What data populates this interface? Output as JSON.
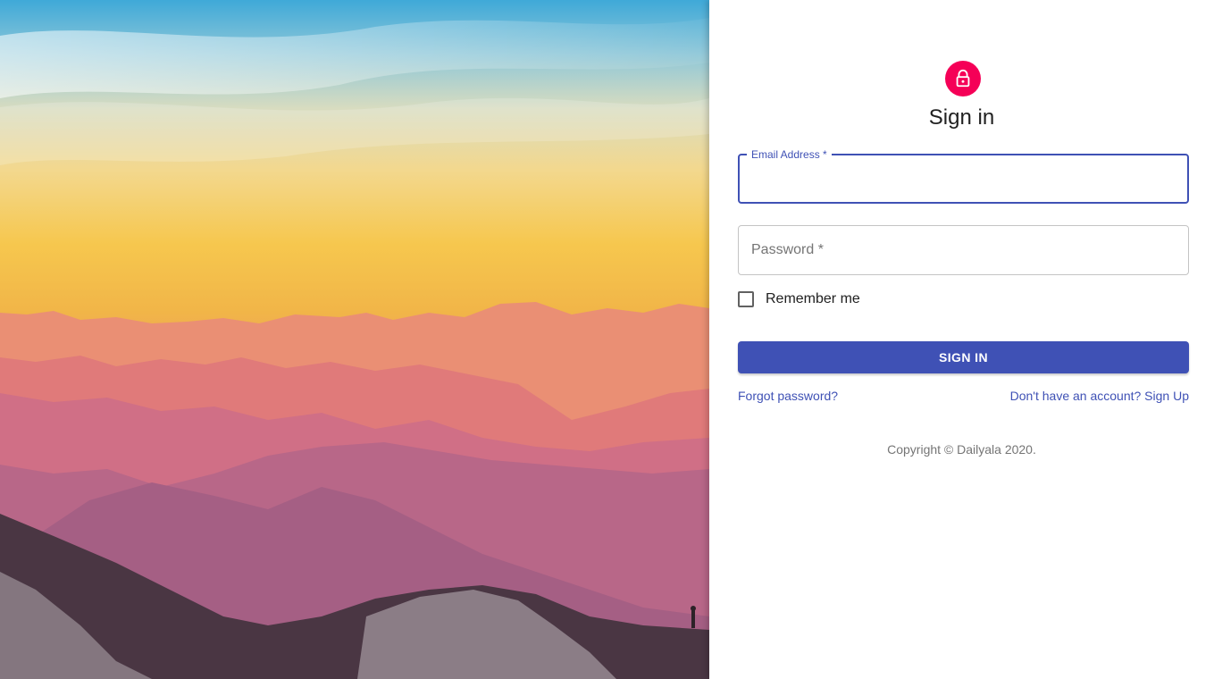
{
  "hero": {
    "image_icon": "mountain-sunset-photo"
  },
  "form": {
    "avatar_icon": "lock-icon",
    "avatar_color": "#f50057",
    "title": "Sign in",
    "email": {
      "label": "Email Address *",
      "value": ""
    },
    "password": {
      "label": "Password *",
      "value": ""
    },
    "remember": {
      "label": "Remember me",
      "checked": false
    },
    "submit_label": "SIGN IN",
    "forgot_link": "Forgot password?",
    "signup_link": "Don't have an account? Sign Up",
    "copyright": "Copyright © Dailyala 2020."
  },
  "colors": {
    "primary": "#3f51b5",
    "secondary": "#f50057"
  }
}
